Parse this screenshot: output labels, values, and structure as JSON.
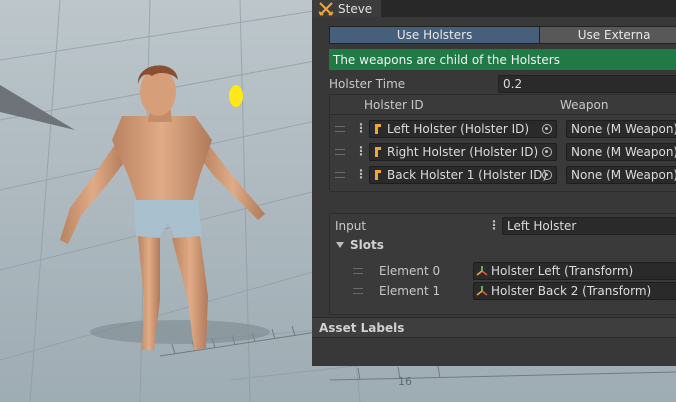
{
  "inspector": {
    "tab_title": "Steve",
    "tab_icon": "crossed-swords-icon",
    "buttons": {
      "use_holsters": "Use Holsters",
      "use_external": "Use Externa"
    },
    "info_message": "The weapons are child of the Holsters",
    "holster_time": {
      "label": "Holster Time",
      "value": "0.2"
    },
    "table": {
      "headers": {
        "holster_id": "Holster ID",
        "weapon": "Weapon"
      },
      "rows": [
        {
          "holster": "Left Holster (Holster ID)",
          "weapon": "None (M Weapon)"
        },
        {
          "holster": "Right Holster (Holster ID)",
          "weapon": "None (M Weapon)"
        },
        {
          "holster": "Back Holster 1 (Holster ID)",
          "weapon": "None (M Weapon)"
        }
      ]
    },
    "input": {
      "label": "Input",
      "value": "Left Holster"
    },
    "slots": {
      "label": "Slots",
      "elements": [
        {
          "label": "Element 0",
          "value": "Holster Left (Transform)"
        },
        {
          "label": "Element 1",
          "value": "Holster Back 2 (Transform)"
        }
      ]
    },
    "asset_labels": "Asset Labels"
  },
  "colors": {
    "panel_bg": "#383838",
    "active_button": "#46607c",
    "info_bar": "#1f7a46",
    "field_bg": "#2a2a2a"
  }
}
